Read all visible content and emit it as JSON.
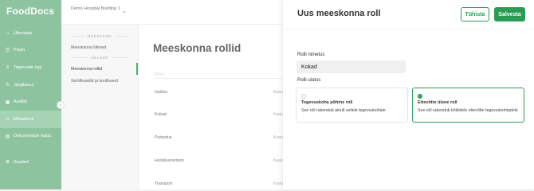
{
  "app": {
    "logo": "FoodDocs"
  },
  "sidebar": {
    "items": [
      {
        "icon": "home-icon",
        "glyph": "⌂",
        "label": "Ülevaade",
        "active": false
      },
      {
        "icon": "list-icon",
        "glyph": "☰",
        "label": "Plaan",
        "active": false
      },
      {
        "icon": "checklist-icon",
        "glyph": "≡",
        "label": "Tegevuste logi",
        "active": false
      },
      {
        "icon": "follow-up-icon",
        "glyph": "↻",
        "label": "Järgitavus",
        "active": false
      },
      {
        "icon": "audit-icon",
        "glyph": "▣",
        "label": "Auditid",
        "active": false
      },
      {
        "icon": "team-icon",
        "glyph": "☺",
        "label": "Meeskond",
        "active": true
      },
      {
        "icon": "document-icon",
        "glyph": "▤",
        "label": "Dokumentide haldu",
        "active": false
      },
      {
        "icon": "gear-icon",
        "glyph": "⚙",
        "label": "Seaded",
        "active": false
      }
    ]
  },
  "topbar": {
    "building": "Demo Hospital Building 1"
  },
  "submenu": {
    "team_heading": "MEESKOND",
    "members": "Meeskonna liikmed",
    "settings_heading": "SEADED",
    "roles": "Meeskonna rollid",
    "certificates": "Sertifikaadid ja koolitused"
  },
  "main": {
    "title": "Meeskonna rollid",
    "column_header": "ROLL",
    "rows": [
      {
        "name": "Haldus",
        "tail": "Kasu"
      },
      {
        "name": "Kokad",
        "tail": "Kasu"
      },
      {
        "name": "Puhastus",
        "tail": "Kasu"
      },
      {
        "name": "Hooldus/remont",
        "tail": "Kasu"
      },
      {
        "name": "Transport",
        "tail": "Kasu"
      }
    ]
  },
  "panel": {
    "title": "Uus meeskonna roll",
    "cancel": "Tühista",
    "save": "Salvesta",
    "name_label": "Rolli nimetus",
    "name_value": "Kokad",
    "scope_label": "Rolli ulatus",
    "options": [
      {
        "title": "Tegevuskoha põhine roll",
        "description": "See roll rakendub ainult sellele tegevuskohale",
        "selected": false
      },
      {
        "title": "Ettevõtte ülene roll",
        "description": "See roll rakendub kõikidele ettevõtte tegevuskohtadele",
        "selected": true
      }
    ]
  },
  "colors": {
    "brand": "#8dc49f",
    "accent": "#2a9d55"
  }
}
